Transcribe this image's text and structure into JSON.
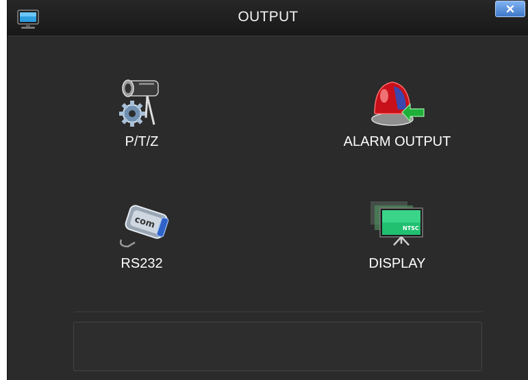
{
  "window": {
    "title": "OUTPUT",
    "close_label": "x"
  },
  "menu": {
    "items": [
      {
        "label": "P/T/Z",
        "icon": "ptz-camera-gear-icon"
      },
      {
        "label": "ALARM OUTPUT",
        "icon": "alarm-siren-icon"
      },
      {
        "label": "RS232",
        "icon": "com-port-icon"
      },
      {
        "label": "DISPLAY",
        "icon": "ntsc-monitor-icon"
      }
    ]
  },
  "colors": {
    "background": "#2b2b2b",
    "titlebar": "#1e1e1e",
    "text": "#ffffff",
    "close_button": "#5a90dc"
  }
}
